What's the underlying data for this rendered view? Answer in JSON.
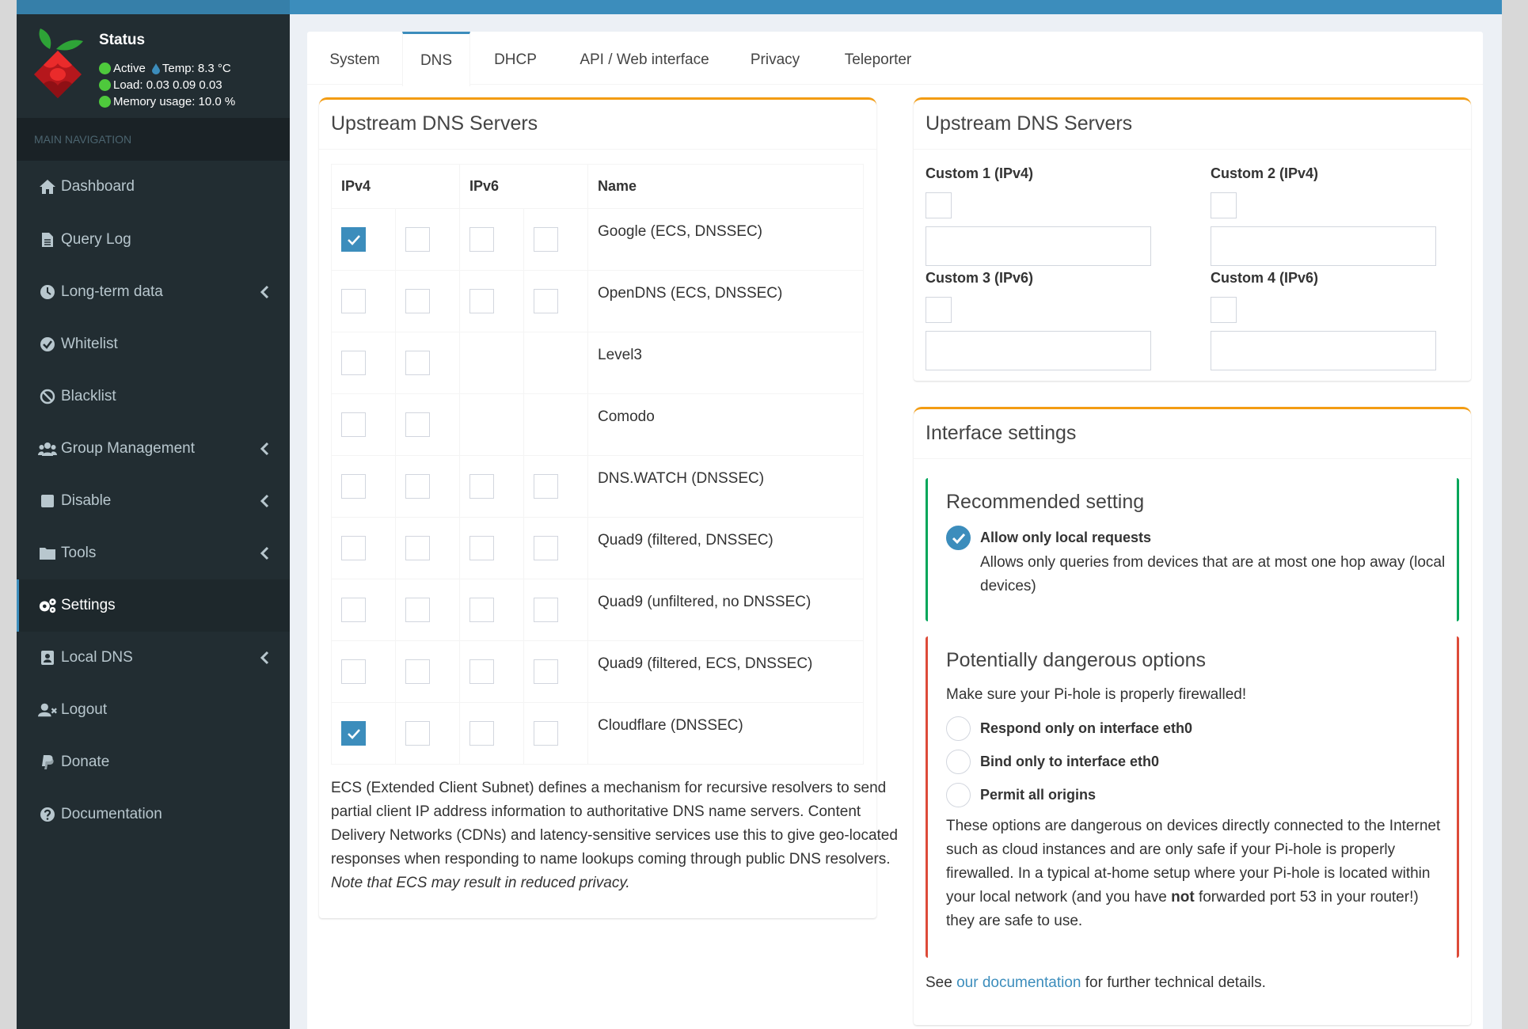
{
  "sidebar": {
    "status_title": "Status",
    "status_active": "Active",
    "status_temp": "Temp: 8.3 °C",
    "status_load": "Load:  0.03  0.09  0.03",
    "status_memory": "Memory usage:  10.0 %",
    "nav_header": "MAIN NAVIGATION",
    "items": [
      {
        "label": "Dashboard",
        "icon": "home-icon"
      },
      {
        "label": "Query Log",
        "icon": "file-icon"
      },
      {
        "label": "Long-term data",
        "icon": "clock-icon"
      },
      {
        "label": "Whitelist",
        "icon": "check-circle-icon"
      },
      {
        "label": "Blacklist",
        "icon": "ban-icon"
      },
      {
        "label": "Group Management",
        "icon": "users-icon"
      },
      {
        "label": "Disable",
        "icon": "square-icon"
      },
      {
        "label": "Tools",
        "icon": "folder-icon"
      },
      {
        "label": "Settings",
        "icon": "cogs-icon"
      },
      {
        "label": "Local DNS",
        "icon": "address-book-icon"
      },
      {
        "label": "Logout",
        "icon": "user-times-icon"
      },
      {
        "label": "Donate",
        "icon": "paypal-icon"
      },
      {
        "label": "Documentation",
        "icon": "question-circle-icon"
      }
    ]
  },
  "tabs": [
    {
      "label": "System"
    },
    {
      "label": "DNS"
    },
    {
      "label": "DHCP"
    },
    {
      "label": "API / Web interface"
    },
    {
      "label": "Privacy"
    },
    {
      "label": "Teleporter"
    }
  ],
  "upstream": {
    "title": "Upstream DNS Servers",
    "col_ipv4": "IPv4",
    "col_ipv6": "IPv6",
    "col_name": "Name",
    "rows": [
      {
        "name": "Google (ECS, DNSSEC)",
        "v4a": true,
        "v4b": false,
        "has_v6": true,
        "v6a": false,
        "v6b": false
      },
      {
        "name": "OpenDNS (ECS, DNSSEC)",
        "v4a": false,
        "v4b": false,
        "has_v6": true,
        "v6a": false,
        "v6b": false
      },
      {
        "name": "Level3",
        "v4a": false,
        "v4b": false,
        "has_v6": false,
        "v6a": false,
        "v6b": false
      },
      {
        "name": "Comodo",
        "v4a": false,
        "v4b": false,
        "has_v6": false,
        "v6a": false,
        "v6b": false
      },
      {
        "name": "DNS.WATCH (DNSSEC)",
        "v4a": false,
        "v4b": false,
        "has_v6": true,
        "v6a": false,
        "v6b": false
      },
      {
        "name": "Quad9 (filtered, DNSSEC)",
        "v4a": false,
        "v4b": false,
        "has_v6": true,
        "v6a": false,
        "v6b": false
      },
      {
        "name": "Quad9 (unfiltered, no DNSSEC)",
        "v4a": false,
        "v4b": false,
        "has_v6": true,
        "v6a": false,
        "v6b": false
      },
      {
        "name": "Quad9 (filtered, ECS, DNSSEC)",
        "v4a": false,
        "v4b": false,
        "has_v6": true,
        "v6a": false,
        "v6b": false
      },
      {
        "name": "Cloudflare (DNSSEC)",
        "v4a": true,
        "v4b": false,
        "has_v6": true,
        "v6a": false,
        "v6b": false
      }
    ],
    "ecs_text": "ECS (Extended Client Subnet) defines a mechanism for recursive resolvers to send partial client IP address information to authoritative DNS name servers. Content Delivery Networks (CDNs) and latency-sensitive services use this to give geo-located responses when responding to name lookups coming through public DNS resolvers.",
    "ecs_note": "Note that ECS may result in reduced privacy."
  },
  "custom": {
    "title": "Upstream DNS Servers",
    "custom1": "Custom 1 (IPv4)",
    "custom2": "Custom 2 (IPv4)",
    "custom3": "Custom 3 (IPv6)",
    "custom4": "Custom 4 (IPv6)"
  },
  "interface": {
    "title": "Interface settings",
    "recommended_title": "Recommended setting",
    "local_label": "Allow only local requests",
    "local_desc": "Allows only queries from devices that are at most one hop away (local devices)",
    "danger_title": "Potentially dangerous options",
    "danger_intro": "Make sure your Pi-hole is properly firewalled!",
    "opt_eth0": "Respond only on interface eth0",
    "opt_bind": "Bind only to interface eth0",
    "opt_all": "Permit all origins",
    "danger_text_1": "These options are dangerous on devices directly connected to the Internet such as cloud instances and are only safe if your Pi-hole is properly firewalled. In a typical at-home setup where your Pi-hole is located within your local network (and you have",
    "danger_not": "not",
    "danger_text_2": "forwarded port 53 in your router!) they are safe to use.",
    "see": "See",
    "doc_link": "our documentation",
    "see_rest": "for further technical details."
  },
  "colors": {
    "accent": "#3c8dbc",
    "warning": "#f39c12",
    "success": "#00a65a",
    "danger": "#dd4b39",
    "sidebar": "#222d32"
  }
}
